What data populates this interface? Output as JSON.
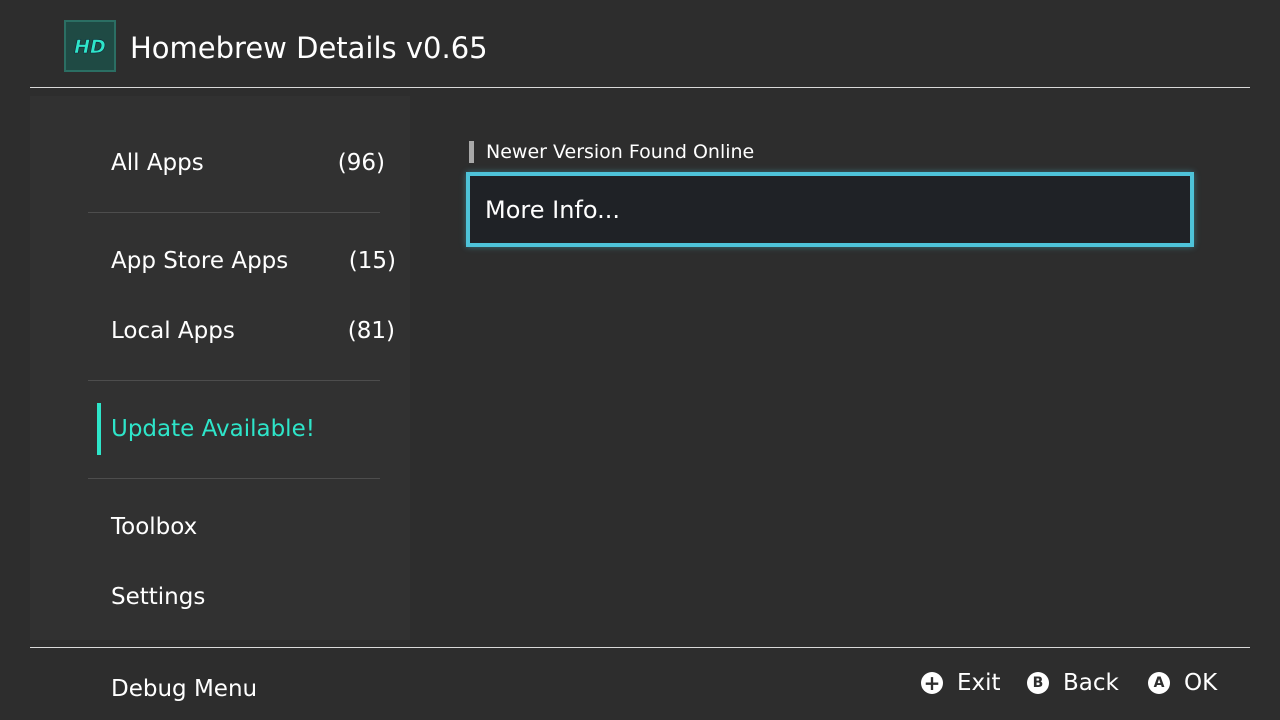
{
  "header": {
    "title": "Homebrew Details v0.65",
    "logo_text": "HD",
    "logo_icon": "hd-logo-icon"
  },
  "sidebar": {
    "items": [
      {
        "label": "All Apps",
        "count": "(96)"
      },
      {
        "label": "App Store Apps",
        "count": "(15)"
      },
      {
        "label": "Local Apps",
        "count": "(81)"
      },
      {
        "label": "Update Available!",
        "count": "",
        "active": true
      },
      {
        "label": "Toolbox",
        "count": ""
      },
      {
        "label": "Settings",
        "count": ""
      },
      {
        "label": "Debug Menu",
        "count": ""
      }
    ]
  },
  "main": {
    "section_label": "Newer Version Found Online",
    "more_info_label": "More Info..."
  },
  "footer": {
    "hints": [
      {
        "icon": "plus-button-icon",
        "glyph": "+",
        "label": "Exit"
      },
      {
        "icon": "b-button-icon",
        "glyph": "B",
        "label": "Back"
      },
      {
        "icon": "a-button-icon",
        "glyph": "A",
        "label": "OK"
      }
    ]
  },
  "colors": {
    "background": "#2d2d2d",
    "sidebar": "#313131",
    "accent_active": "#2ee5c9",
    "focus_border": "#4ec3d9",
    "logo_bg": "#1f4a44"
  }
}
